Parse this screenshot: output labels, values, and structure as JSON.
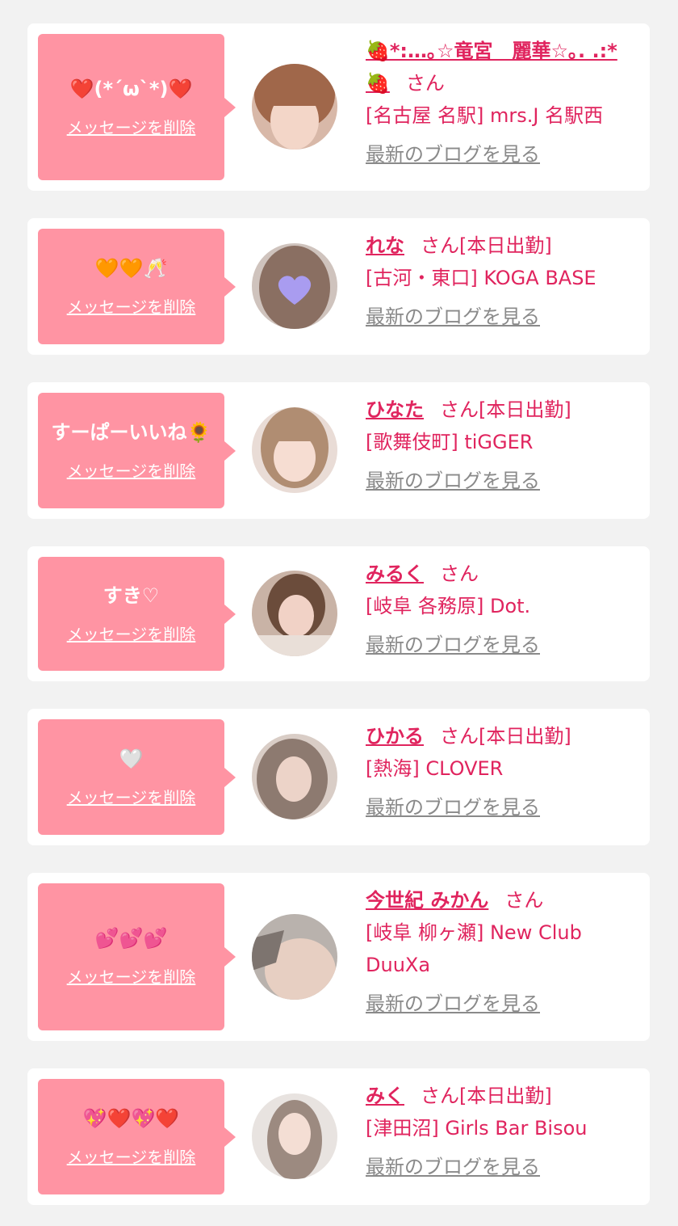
{
  "cards": [
    {
      "message": "❤️(*´ω`*)❤️",
      "delete_label": "メッセージを削除",
      "name": "🍓*:…｡☆竜宮　麗華☆｡. .:*🍓",
      "san": "さん",
      "status": "",
      "shop": "[名古屋 名駅] mrs.J 名駅西",
      "blog_label": "最新のブログを見る",
      "avatar": {
        "bg": "#d8b8a8",
        "hair": "#a0674a",
        "skin": "#f3d6c8"
      }
    },
    {
      "message": "🧡🧡🥂",
      "delete_label": "メッセージを削除",
      "name": "れな",
      "san": "さん",
      "status": "[本日出勤]",
      "shop": "[古河・東口] KOGA BASE",
      "blog_label": "最新のブログを見る",
      "avatar": {
        "bg": "#cfc3bd",
        "hair": "#8a6f62",
        "skin": "#a99cf0"
      }
    },
    {
      "message": "すーぱーいいね🌻",
      "delete_label": "メッセージを削除",
      "name": "ひなた",
      "san": "さん",
      "status": "[本日出勤]",
      "shop": "[歌舞伎町] tiGGER",
      "blog_label": "最新のブログを見る",
      "avatar": {
        "bg": "#e9dcd6",
        "hair": "#b08d72",
        "skin": "#f6ddd2"
      }
    },
    {
      "message": "すき♡",
      "delete_label": "メッセージを削除",
      "name": "みるく",
      "san": "さん",
      "status": "",
      "shop": "[岐阜 各務原] Dot.",
      "blog_label": "最新のブログを見る",
      "avatar": {
        "bg": "#c9b3a6",
        "hair": "#6b4c3b",
        "skin": "#f1d2c6"
      }
    },
    {
      "message": "🤍",
      "delete_label": "メッセージを削除",
      "name": "ひかる",
      "san": "さん",
      "status": "[本日出勤]",
      "shop": "[熱海] CLOVER",
      "blog_label": "最新のブログを見る",
      "avatar": {
        "bg": "#d9cdc6",
        "hair": "#8d7a70",
        "skin": "#ecd3c8"
      }
    },
    {
      "message": "💕💕💕",
      "delete_label": "メッセージを削除",
      "name": "今世紀 みかん",
      "san": "さん",
      "status": "",
      "shop": "[岐阜 柳ヶ瀬] New Club DuuXa",
      "blog_label": "最新のブログを見る",
      "avatar": {
        "bg": "#b9b2ad",
        "hair": "#7d746f",
        "skin": "#e7cfc2"
      }
    },
    {
      "message": "💖❤️💖❤️",
      "delete_label": "メッセージを削除",
      "name": "みく",
      "san": "さん",
      "status": "[本日出勤]",
      "shop": "[津田沼] Girls Bar Bisou",
      "blog_label": "最新のブログを見る",
      "avatar": {
        "bg": "#e8e3e0",
        "hair": "#9c8a80",
        "skin": "#f4ded4"
      }
    }
  ]
}
